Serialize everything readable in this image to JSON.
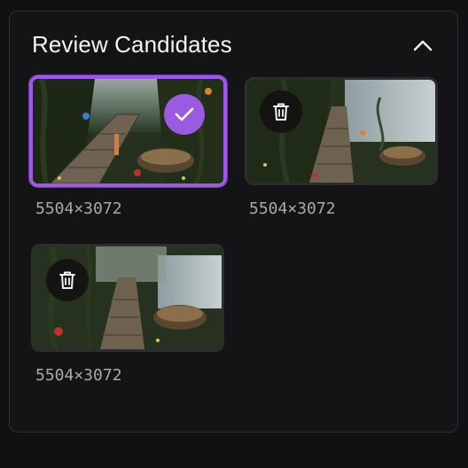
{
  "panel": {
    "title": "Review Candidates",
    "collapse_icon": "chevron-up-icon"
  },
  "candidates": [
    {
      "dimensions": "5504×3072",
      "selected": true,
      "badge_icon": "checkmark-icon"
    },
    {
      "dimensions": "5504×3072",
      "selected": false,
      "action_icon": "trash-icon"
    },
    {
      "dimensions": "5504×3072",
      "selected": false,
      "action_icon": "trash-icon"
    }
  ],
  "colors": {
    "accent": "#9b5be0",
    "background": "#111113",
    "panel_border": "#2e2e33",
    "title_text": "#f2f2f4",
    "meta_text": "#a9a9ae"
  }
}
